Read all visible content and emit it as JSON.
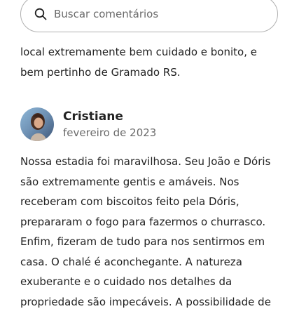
{
  "search": {
    "placeholder": "Buscar comentários",
    "value": ""
  },
  "previous_review": {
    "text": "local extremamente bem cuidado e bonito, e bem pertinho de Gramado RS."
  },
  "review": {
    "reviewer_name": "Cristiane",
    "date": "fevereiro de 2023",
    "text": "Nossa estadia foi maravilhosa. Seu João e Dóris são extremamente gentis e amáveis. Nos receberam com biscoitos feito pela Dóris, prepararam o fogo para fazermos o churrasco. Enfim, fizeram de tudo para nos sentirmos em casa. O chalé é aconchegante. A natureza exuberante e o cuidado nos detalhes da propriedade são impecáveis. A possibilidade de"
  },
  "icons": {
    "search": "search-icon",
    "avatar": "avatar"
  },
  "colors": {
    "text_primary": "#222222",
    "text_secondary": "#6a6a6a",
    "border": "#b0b0b0"
  }
}
